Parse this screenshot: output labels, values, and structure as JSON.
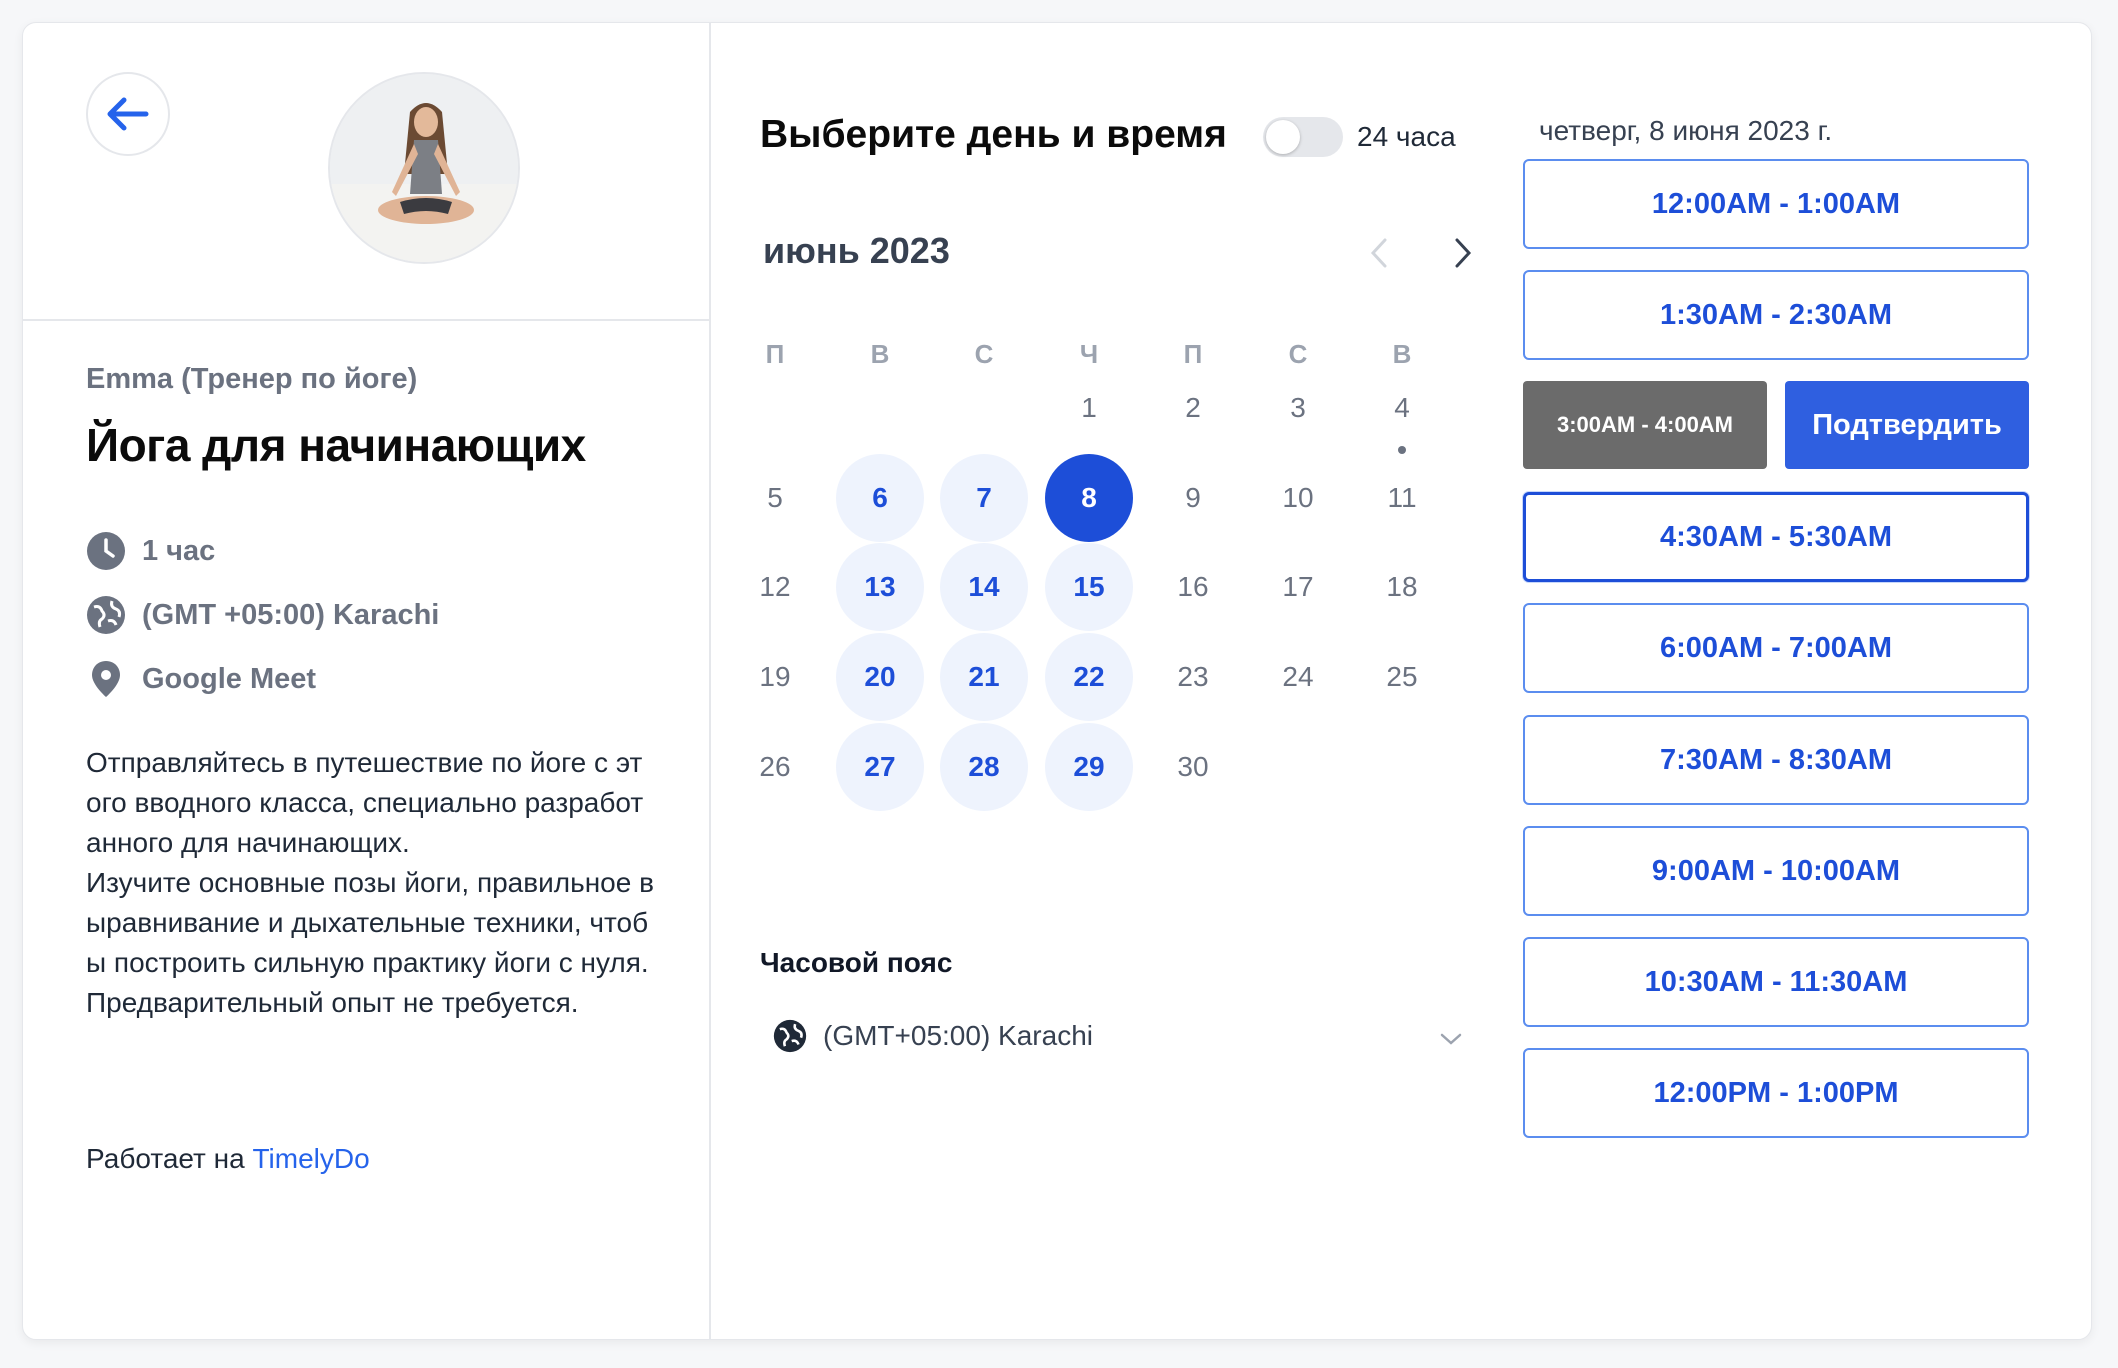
{
  "host": {
    "trainer": "Emma (Тренер по йоге)",
    "title": "Йога для начинающих",
    "duration": "1 час",
    "timezone": "(GMT +05:00) Karachi",
    "location": "Google Meet",
    "description": "Отправляйтесь в путешествие по йоге с этого вводного класса, специально разработанного для начинающих.\nИзучите основные позы йоги, правильное выравнивание и дыхательные техники, чтобы построить сильную практику йоги с нуля. Предварительный опыт не требуется.",
    "powered_prefix": "Работает на ",
    "powered_link": "TimelyDo"
  },
  "calendar": {
    "heading": "Выберите день и время",
    "toggle_label": "24 часа",
    "toggle_on": false,
    "month": "июнь 2023",
    "weekdays": [
      "П",
      "В",
      "С",
      "Ч",
      "П",
      "С",
      "В"
    ],
    "first_weekday_index": 3,
    "days_in_month": 30,
    "available_days": [
      6,
      7,
      13,
      14,
      15,
      20,
      21,
      22,
      27,
      28,
      29
    ],
    "selected_day": 8,
    "today_marker_day": 4,
    "timezone_label": "Часовой пояс",
    "timezone_value": "(GMT+05:00) Karachi"
  },
  "slots": {
    "date_header": "четверг, 8 июня 2023 г.",
    "items": [
      "12:00AM - 1:00AM",
      "1:30AM - 2:30AM",
      "3:00AM - 4:00AM",
      "4:30AM - 5:30AM",
      "6:00AM - 7:00AM",
      "7:30AM - 8:30AM",
      "9:00AM - 10:00AM",
      "10:30AM - 11:30AM",
      "12:00PM - 1:00PM"
    ],
    "selected_index": 2,
    "focused_index": 3,
    "confirm_label": "Подтвердить"
  },
  "colors": {
    "accent": "#1d4ed8",
    "available_bg": "#eef3fd",
    "selected_slot_bg": "#6b6b6b",
    "confirm_bg": "#2f5fe0"
  }
}
